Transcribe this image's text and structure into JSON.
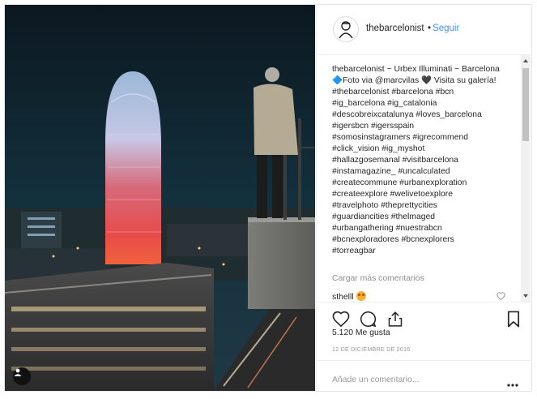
{
  "post": {
    "username": "thebarcelonist",
    "follow_separator": "•",
    "follow_label": "Seguir",
    "caption_text": "~ Urbex Illuminati ~ Barcelona 🔷Foto via @marcvilas 🖤 Visita su galería!",
    "hashtag_lines": [
      "#thebarcelonist #barcelona #bcn",
      "#ig_barcelona #ig_catalonia",
      "#descobreixcatalunya #loves_barcelona",
      "#igersbcn #igersspain",
      "#somosinstagramers #igrecommend",
      "#click_vision #ig_myshot",
      "#hallazgosemanal #visitbarcelona",
      "#instamagazine_ #uncalculated",
      "#createcommune #urbanexploration",
      "#createexplore #welivetoexplore",
      "#travelphoto #theprettycities",
      "#guardiancities #thelmaged",
      "#urbangathering #nuestrabcn",
      "#bcnexploradores #bcnexplorers",
      "#torreagbar"
    ],
    "load_more_label": "Cargar más comentarios",
    "comment_user": "sthelll",
    "likes_label": "5.120 Me gusta",
    "date_label": "12 DE DICIEMBRE DE 2016",
    "add_comment_placeholder": "Añade un comentario...",
    "more_options": "•••"
  },
  "icons": {
    "like": "heart-icon",
    "comment": "comment-icon",
    "share": "share-icon",
    "save": "bookmark-icon",
    "user_tag": "user-tag-icon"
  },
  "colors": {
    "link_blue": "#3897f0",
    "text": "#262626",
    "muted": "#8e8e8e",
    "border": "#efefef"
  }
}
